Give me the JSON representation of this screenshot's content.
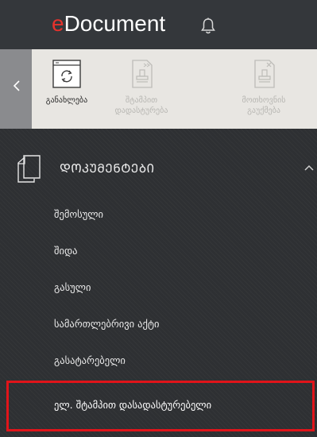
{
  "header": {
    "logo_prefix": "e",
    "logo_text": "Document",
    "bell_icon": "bell-icon",
    "accent_color": "#e5322d"
  },
  "toolbar": {
    "back_icon": "chevron-left-icon",
    "buttons": [
      {
        "label": "განახლება",
        "icon": "refresh-document-icon",
        "state": "enabled"
      },
      {
        "label": "შტამპით დადასტურება",
        "icon": "stamp-confirm-icon",
        "state": "disabled"
      },
      {
        "label": "მოთხოვნის გაუქმება",
        "icon": "cancel-request-icon",
        "state": "disabled"
      }
    ]
  },
  "menu": {
    "section_title": "ᲓᲝᲙᲣᲛᲔᲜᲢᲔᲑᲘ",
    "section_icon": "documents-icon",
    "collapse_icon": "chevron-up-icon",
    "items": [
      {
        "label": "შემოსული"
      },
      {
        "label": "შიდა"
      },
      {
        "label": "გასული"
      },
      {
        "label": "სამართლებრივი აქტი"
      },
      {
        "label": "გასატარებელი"
      },
      {
        "label": "ელ. შტამპით დასადასტურებელი",
        "highlighted": true
      }
    ],
    "highlight_color": "#e1141a"
  }
}
